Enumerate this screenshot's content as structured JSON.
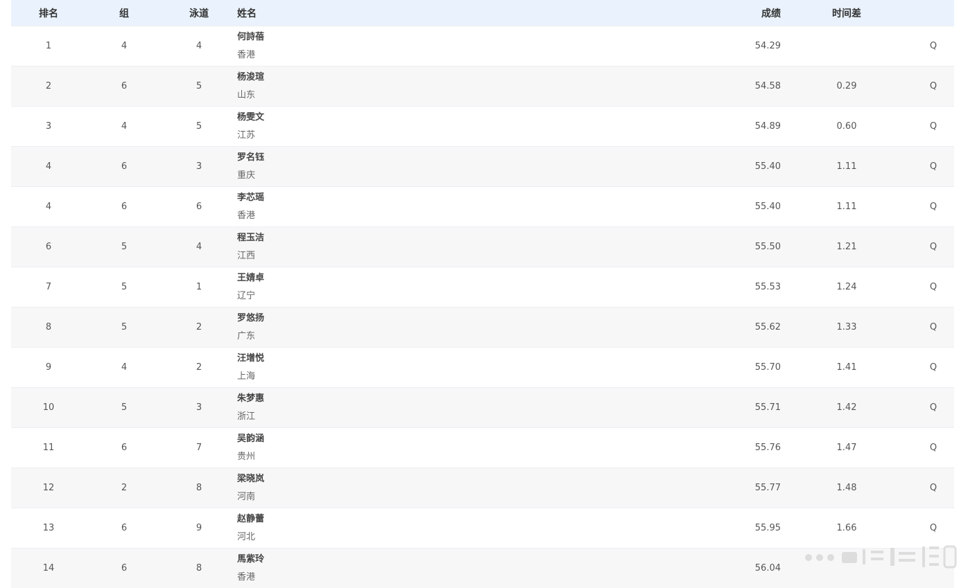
{
  "table": {
    "headers": {
      "rank": "排名",
      "group": "组",
      "lane": "泳道",
      "name": "姓名",
      "time": "成绩",
      "diff": "时间差"
    },
    "rows": [
      {
        "rank": "1",
        "group": "4",
        "lane": "4",
        "name": "何詩蓓",
        "team": "香港",
        "time": "54.29",
        "diff": "",
        "q": "Q"
      },
      {
        "rank": "2",
        "group": "6",
        "lane": "5",
        "name": "杨浚瑄",
        "team": "山东",
        "time": "54.58",
        "diff": "0.29",
        "q": "Q"
      },
      {
        "rank": "3",
        "group": "4",
        "lane": "5",
        "name": "杨雯文",
        "team": "江苏",
        "time": "54.89",
        "diff": "0.60",
        "q": "Q"
      },
      {
        "rank": "4",
        "group": "6",
        "lane": "3",
        "name": "罗名钰",
        "team": "重庆",
        "time": "55.40",
        "diff": "1.11",
        "q": "Q"
      },
      {
        "rank": "4",
        "group": "6",
        "lane": "6",
        "name": "李芯瑶",
        "team": "香港",
        "time": "55.40",
        "diff": "1.11",
        "q": "Q"
      },
      {
        "rank": "6",
        "group": "5",
        "lane": "4",
        "name": "程玉洁",
        "team": "江西",
        "time": "55.50",
        "diff": "1.21",
        "q": "Q"
      },
      {
        "rank": "7",
        "group": "5",
        "lane": "1",
        "name": "王婧卓",
        "team": "辽宁",
        "time": "55.53",
        "diff": "1.24",
        "q": "Q"
      },
      {
        "rank": "8",
        "group": "5",
        "lane": "2",
        "name": "罗悠扬",
        "team": "广东",
        "time": "55.62",
        "diff": "1.33",
        "q": "Q"
      },
      {
        "rank": "9",
        "group": "4",
        "lane": "2",
        "name": "汪增悦",
        "team": "上海",
        "time": "55.70",
        "diff": "1.41",
        "q": "Q"
      },
      {
        "rank": "10",
        "group": "5",
        "lane": "3",
        "name": "朱梦惠",
        "team": "浙江",
        "time": "55.71",
        "diff": "1.42",
        "q": "Q"
      },
      {
        "rank": "11",
        "group": "6",
        "lane": "7",
        "name": "吴韵涵",
        "team": "贵州",
        "time": "55.76",
        "diff": "1.47",
        "q": "Q"
      },
      {
        "rank": "12",
        "group": "2",
        "lane": "8",
        "name": "梁晓岚",
        "team": "河南",
        "time": "55.77",
        "diff": "1.48",
        "q": "Q"
      },
      {
        "rank": "13",
        "group": "6",
        "lane": "9",
        "name": "赵静蕾",
        "team": "河北",
        "time": "55.95",
        "diff": "1.66",
        "q": "Q"
      },
      {
        "rank": "14",
        "group": "6",
        "lane": "8",
        "name": "馬紫玲",
        "team": "香港",
        "time": "56.04",
        "diff": "",
        "q": ""
      }
    ]
  },
  "colors": {
    "header_bg": "#eaf3fd",
    "row_alt_bg": "#f7f7f7",
    "text": "#555555"
  }
}
